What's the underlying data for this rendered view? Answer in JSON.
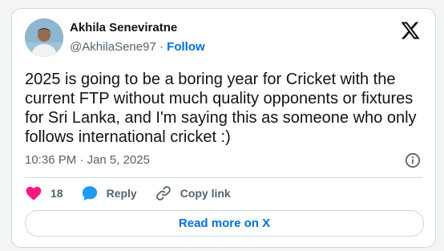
{
  "author": {
    "display_name": "Akhila Seneviratne",
    "handle": "@AkhilaSene97",
    "separator": "·",
    "follow_label": "Follow"
  },
  "tweet": {
    "text": "2025 is going to be a boring year for Cricket with the current FTP without much quality opponents or fixtures for Sri Lanka, and I'm saying this as someone who only follows international cricket :)",
    "time": "10:36 PM",
    "date": "Jan 5, 2025"
  },
  "actions": {
    "like_count": "18",
    "reply_label": "Reply",
    "copy_label": "Copy link"
  },
  "footer": {
    "read_more_label": "Read more on X"
  },
  "icons": {
    "logo": "x-logo-icon",
    "info": "info-icon",
    "like": "heart-icon",
    "reply": "speech-bubble-icon",
    "copy": "link-icon"
  },
  "colors": {
    "like": "#f91880",
    "reply": "#1d9bf0",
    "link": "#006fd6",
    "muted": "#536471",
    "text": "#0f1419"
  }
}
